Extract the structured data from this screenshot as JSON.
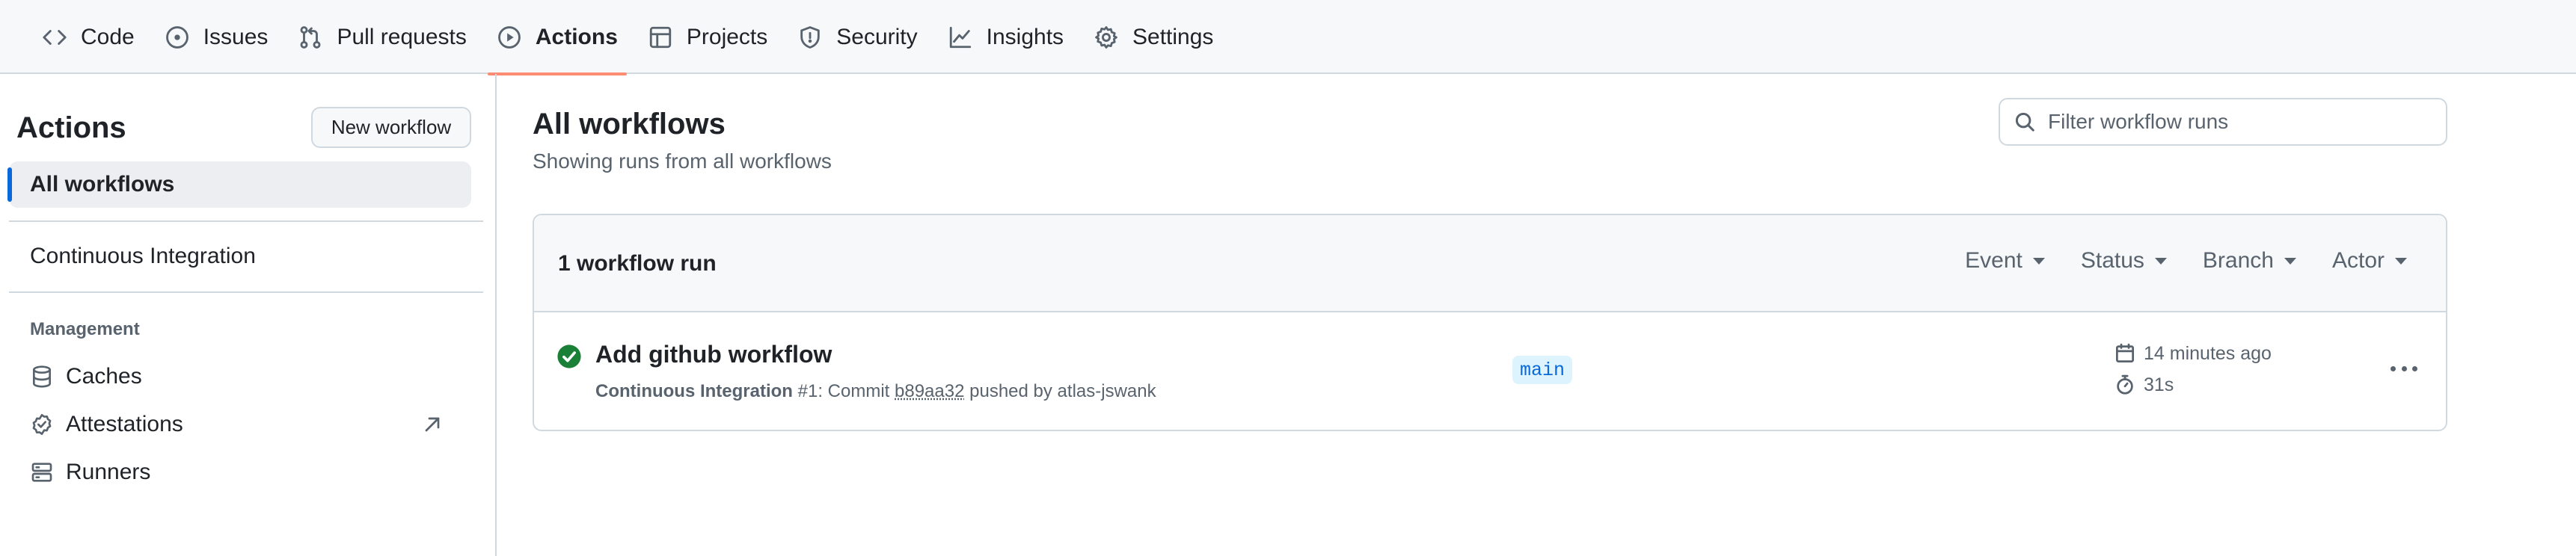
{
  "repo_nav": {
    "tabs": [
      {
        "label": "Code",
        "icon": "code-icon"
      },
      {
        "label": "Issues",
        "icon": "issue-opened-icon"
      },
      {
        "label": "Pull requests",
        "icon": "git-pull-request-icon"
      },
      {
        "label": "Actions",
        "icon": "play-icon",
        "selected": true
      },
      {
        "label": "Projects",
        "icon": "table-icon"
      },
      {
        "label": "Security",
        "icon": "shield-icon"
      },
      {
        "label": "Insights",
        "icon": "graph-icon"
      },
      {
        "label": "Settings",
        "icon": "gear-icon"
      }
    ],
    "selected_underline_color": "#fd8c73"
  },
  "sidebar": {
    "title": "Actions",
    "new_workflow_label": "New workflow",
    "all_workflows_label": "All workflows",
    "workflows": [
      {
        "label": "Continuous Integration"
      }
    ],
    "management_heading": "Management",
    "management_items": [
      {
        "label": "Caches",
        "icon": "database-icon"
      },
      {
        "label": "Attestations",
        "icon": "verified-icon",
        "external": true
      },
      {
        "label": "Runners",
        "icon": "server-icon"
      }
    ],
    "active_marker_color": "#0969da"
  },
  "main": {
    "title": "All workflows",
    "subtitle": "Showing runs from all workflows",
    "filter_placeholder": "Filter workflow runs",
    "run_count_label": "1 workflow run",
    "filters": [
      "Event",
      "Status",
      "Branch",
      "Actor"
    ],
    "runs": [
      {
        "status": "success",
        "status_color": "#1a7f37",
        "title": "Add github workflow",
        "workflow_name": "Continuous Integration",
        "run_number": "#1",
        "commit_prefix": ": Commit",
        "commit_sha": "b89aa32",
        "pushed_by_text": "pushed by atlas-jswank",
        "branch": "main",
        "time_ago": "14 minutes ago",
        "duration": "31s"
      }
    ]
  }
}
